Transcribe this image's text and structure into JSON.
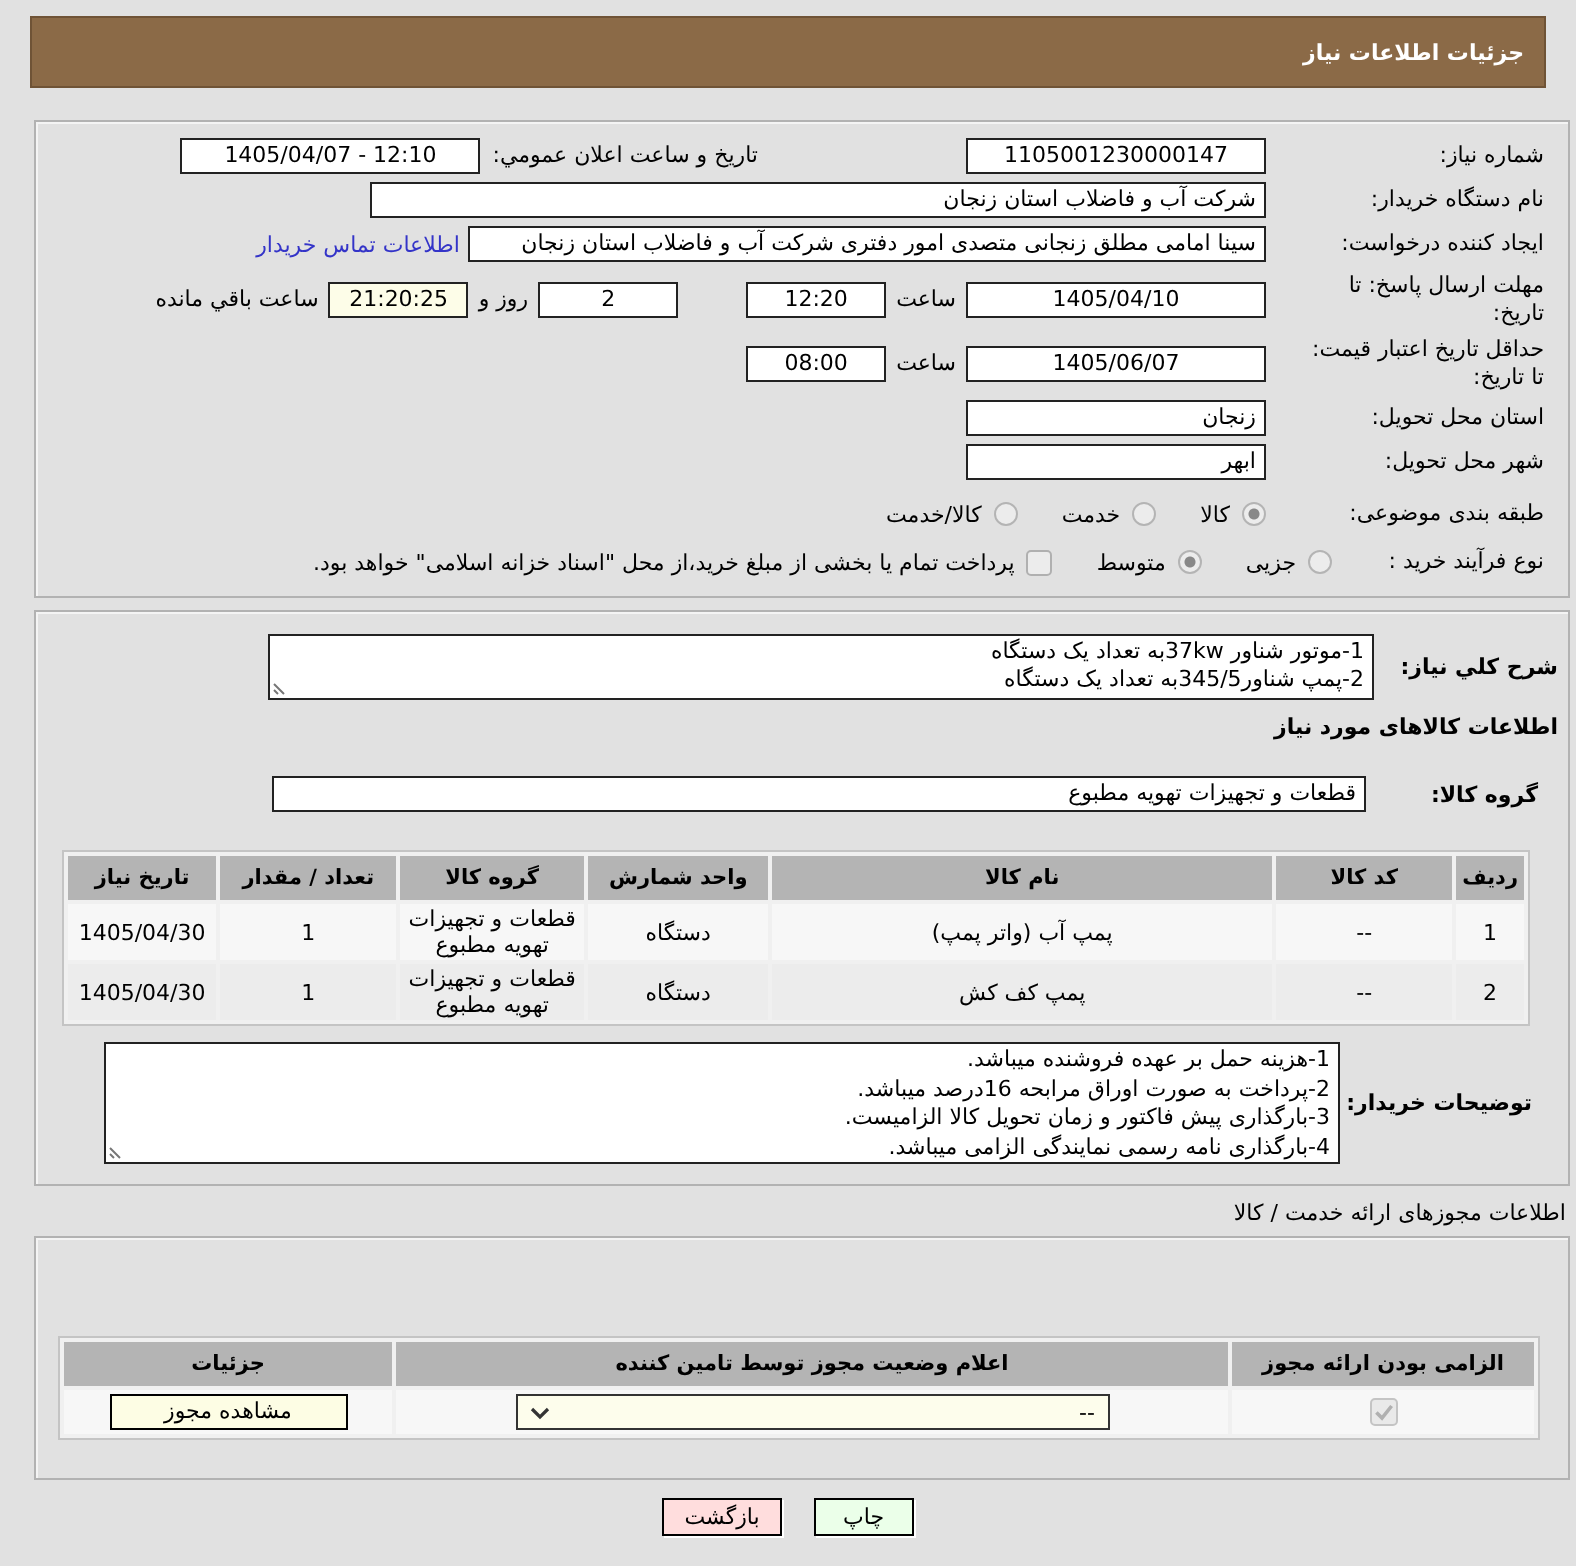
{
  "header": {
    "title": "جزئیات اطلاعات نیاز"
  },
  "need_number": {
    "label": "شماره نیاز:",
    "value": "1105001230000147"
  },
  "announcement": {
    "label": "تاریخ و ساعت اعلان عمومي:",
    "value": "1405/04/07 - 12:10"
  },
  "buyer_org": {
    "label": "نام دستگاه خریدار:",
    "value": "شرکت آب و فاضلاب استان زنجان"
  },
  "requester": {
    "label": "ایجاد کننده درخواست:",
    "value": "سینا امامی مطلق زنجانی متصدی امور دفتری شرکت آب و فاضلاب استان زنجان",
    "contact_link": "اطلاعات تماس خریدار"
  },
  "reply_deadline": {
    "label": "مهلت ارسال پاسخ: تا تاریخ:",
    "date": "1405/04/10",
    "time_label": "ساعت",
    "time": "12:20",
    "days": "2",
    "days_label": "روز و",
    "remaining": "21:20:25",
    "remaining_label": "ساعت باقي مانده"
  },
  "price_validity": {
    "label": "حداقل تاریخ اعتبار قیمت: تا تاریخ:",
    "date": "1405/06/07",
    "time_label": "ساعت",
    "time": "08:00"
  },
  "delivery_province": {
    "label": "استان محل تحویل:",
    "value": "زنجان"
  },
  "delivery_city": {
    "label": "شهر محل تحویل:",
    "value": "ابهر"
  },
  "category": {
    "label": "طبقه بندی موضوعی:",
    "options": [
      {
        "label": "کالا",
        "selected": true
      },
      {
        "label": "خدمت",
        "selected": false
      },
      {
        "label": "کالا/خدمت",
        "selected": false
      }
    ]
  },
  "purchase_type": {
    "label": "نوع فرآیند خرید :",
    "options": [
      {
        "label": "جزیی",
        "selected": false
      },
      {
        "label": "متوسط",
        "selected": true
      }
    ],
    "treasury": {
      "label": "پرداخت تمام یا بخشی از مبلغ خرید،از محل \"اسناد خزانه اسلامی\" خواهد بود.",
      "checked": false
    }
  },
  "description": {
    "label": "شرح کلي نياز:",
    "text": "1-موتور شناور 37kwبه تعداد یک دستگاه\n2-پمپ شناور345/5به تعداد یک دستگاه"
  },
  "goods": {
    "title": "اطلاعات کالاهای مورد نیاز",
    "group_label": "گروه کالا:",
    "group": "قطعات و تجهیزات تهویه مطبوع",
    "columns": [
      "ردیف",
      "کد کالا",
      "نام کالا",
      "واحد شمارش",
      "گروه کالا",
      "تعداد / مقدار",
      "تاریخ نیاز"
    ],
    "rows": [
      [
        "1",
        "--",
        "پمپ آب (واتر پمپ)",
        "دستگاه",
        "قطعات و تجهیزات تهویه مطبوع",
        "1",
        "1405/04/30"
      ],
      [
        "2",
        "--",
        "پمپ کف کش",
        "دستگاه",
        "قطعات و تجهیزات تهویه مطبوع",
        "1",
        "1405/04/30"
      ]
    ]
  },
  "buyer_notes": {
    "label": "توضیحات خریدار:",
    "text": "1-هزینه حمل بر عهده فروشنده میباشد.\n2-پرداخت به صورت اوراق مرابحه 16درصد میباشد.\n3-بارگذاری پیش فاکتور و زمان تحویل کالا الزامیست.\n4-بارگذاری نامه رسمی نمایندگی الزامی میباشد."
  },
  "permits": {
    "title": "اطلاعات مجوزهای ارائه خدمت / کالا",
    "columns": [
      "الزامی بودن ارائه مجوز",
      "اعلام وضعیت مجوز توسط تامین کننده",
      "جزئیات"
    ],
    "rows": [
      {
        "required": true,
        "status": "--",
        "action": "مشاهده مجوز"
      }
    ]
  },
  "buttons": [
    {
      "label": "چاپ",
      "kind": "print"
    },
    {
      "label": "بازگشت",
      "kind": "back"
    }
  ]
}
